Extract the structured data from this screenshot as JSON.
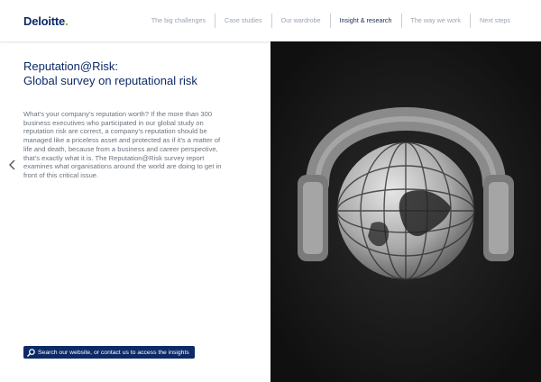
{
  "header": {
    "logo_text": "Deloitte",
    "logo_dot": ".",
    "nav": [
      {
        "label": "The big challenges",
        "active": false
      },
      {
        "label": "Case studies",
        "active": false
      },
      {
        "label": "Our wardrobe",
        "active": false
      },
      {
        "label": "Insight & research",
        "active": true
      },
      {
        "label": "The way we work",
        "active": false
      },
      {
        "label": "Next steps",
        "active": false
      }
    ]
  },
  "main": {
    "title_line1": "Reputation@Risk:",
    "title_line2": "Global survey on reputational risk",
    "body": "What’s your company’s reputation worth? If the more than 300 business executives who participated in our global study on reputation risk are correct, a company’s reputation should be managed like a priceless asset and protected as if it’s a matter of life and death, because from a business and career perspective, that’s exactly what it is. The Reputation@Risk survey report examines what organisations around the world are doing to get in front of this critical issue.",
    "search_label": "Search our website, or contact us to access the insights"
  },
  "icons": {
    "prev": "chevron-left-icon",
    "next": "chevron-right-icon",
    "search": "magnifier-icon"
  },
  "colors": {
    "brand_navy": "#0d2a67",
    "brand_green": "#86bc25",
    "image_bg": "#141414"
  }
}
